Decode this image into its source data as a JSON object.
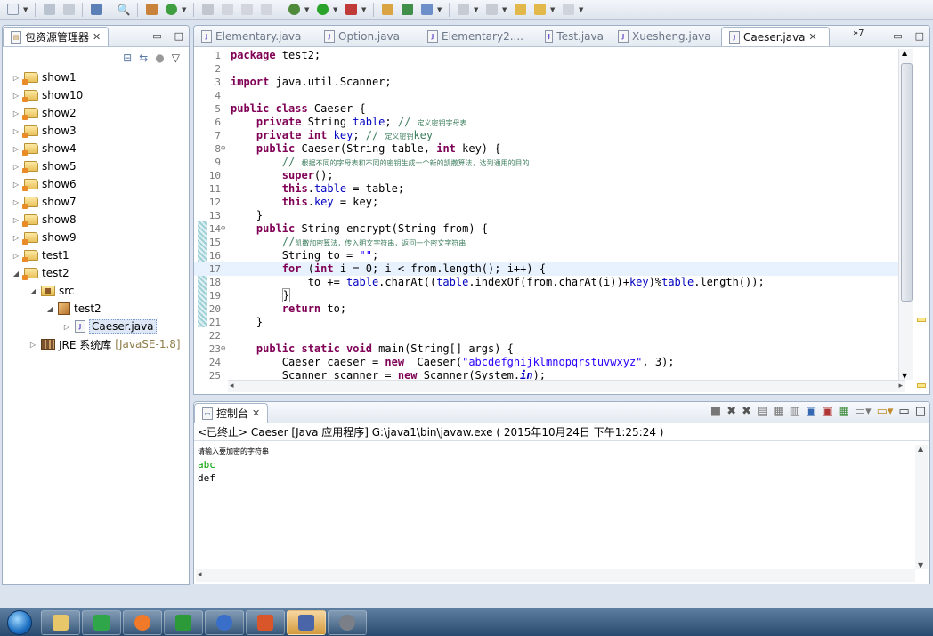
{
  "explorer": {
    "title": "包资源管理器",
    "projects": [
      {
        "label": "show1"
      },
      {
        "label": "show10"
      },
      {
        "label": "show2"
      },
      {
        "label": "show3"
      },
      {
        "label": "show4"
      },
      {
        "label": "show5"
      },
      {
        "label": "show6"
      },
      {
        "label": "show7"
      },
      {
        "label": "show8"
      },
      {
        "label": "show9"
      },
      {
        "label": "test1"
      },
      {
        "label": "test2"
      }
    ],
    "src": "src",
    "package": "test2",
    "file": "Caeser.java",
    "jre": "JRE 系统库",
    "jre_version": "[JavaSE-1.8]"
  },
  "editor": {
    "tabs": [
      {
        "label": "Elementary.java"
      },
      {
        "label": "Option.java"
      },
      {
        "label": "Elementary2...."
      },
      {
        "label": "Test.java"
      },
      {
        "label": "Xuesheng.java"
      },
      {
        "label": "Caeser.java"
      }
    ],
    "overflow": "»7",
    "lines": [
      {
        "n": "1",
        "html": "<span class=\"kw\">package</span> test2;"
      },
      {
        "n": "2",
        "html": ""
      },
      {
        "n": "3",
        "html": "<span class=\"kw\">import</span> java.util.Scanner;"
      },
      {
        "n": "4",
        "html": ""
      },
      {
        "n": "5",
        "html": "<span class=\"kw\">public class</span> Caeser {"
      },
      {
        "n": "6",
        "html": "    <span class=\"kw\">private</span> String <span class=\"fld\">table</span>; <span style=\"color:#3f7f5f\">//</span> <span class=\"cmt\">定义密钥字母表</span>"
      },
      {
        "n": "7",
        "html": "    <span class=\"kw\">private int</span> <span class=\"fld\">key</span>; <span style=\"color:#3f7f5f\">//</span> <span class=\"cmt\">定义密钥</span><span style=\"color:#3f7f5f\">key</span>"
      },
      {
        "n": "8",
        "html": "    <span class=\"kw\">public</span> Caeser(String table, <span class=\"kw\">int</span> key) {"
      },
      {
        "n": "9",
        "html": "        <span style=\"color:#3f7f5f\">//</span> <span class=\"cmt\">根据不同的字母表和不同的密钥生成一个新的凯撒算法，达到通用的目的</span>"
      },
      {
        "n": "10",
        "html": "        <span class=\"kw\">super</span>();"
      },
      {
        "n": "11",
        "html": "        <span class=\"kw\">this</span>.<span class=\"fld\">table</span> = table;"
      },
      {
        "n": "12",
        "html": "        <span class=\"kw\">this</span>.<span class=\"fld\">key</span> = key;"
      },
      {
        "n": "13",
        "html": "    }"
      },
      {
        "n": "14",
        "html": "    <span class=\"kw\">public</span> String encrypt(String from) {"
      },
      {
        "n": "15",
        "html": "        <span style=\"color:#3f7f5f\">//</span><span class=\"cmt\">凯撒加密算法，传入明文字符串，返回一个密文字符串</span>"
      },
      {
        "n": "16",
        "html": "        String to = <span class=\"str\">\"\"</span>;"
      },
      {
        "n": "17",
        "html": "        <span class=\"kw\">for</span> (<span class=\"kw\">int</span> i = 0; i &lt; from.length(); i++) {"
      },
      {
        "n": "18",
        "html": "            to += <span class=\"fld\">table</span>.charAt((<span class=\"fld\">table</span>.indexOf(from.charAt(i))+<span class=\"fld\">key</span>)%<span class=\"fld\">table</span>.length());"
      },
      {
        "n": "19",
        "html": "        <span style=\"border:1px solid #9a9a9a\">}</span>"
      },
      {
        "n": "20",
        "html": "        <span class=\"kw\">return</span> to;"
      },
      {
        "n": "21",
        "html": "    }"
      },
      {
        "n": "22",
        "html": ""
      },
      {
        "n": "23",
        "html": "    <span class=\"kw\">public static void</span> main(String[] args) {"
      },
      {
        "n": "24",
        "html": "        Caeser caeser = <span class=\"kw\">new</span>  Caeser(<span class=\"str\">\"abcdefghijklmnopqrstuvwxyz\"</span>, 3);"
      },
      {
        "n": "25",
        "html": "        Scanner scanner = <span class=\"kw\">new</span> Scanner(System.<span class=\"fld\" style=\"font-style:italic;font-weight:bold\">in</span>);"
      }
    ]
  },
  "console": {
    "title": "控制台",
    "status": "<已终止> Caeser [Java 应用程序] G:\\java1\\bin\\javaw.exe ( 2015年10月24日 下午1:25:24 )",
    "prompt": "请输入要加密的字符串",
    "input": "abc",
    "output": "def"
  },
  "colors": {
    "keyword": "#7f0055",
    "field": "#0000c0",
    "comment": "#3f7f5f",
    "string": "#2a00ff",
    "console_input": "#00a000"
  }
}
